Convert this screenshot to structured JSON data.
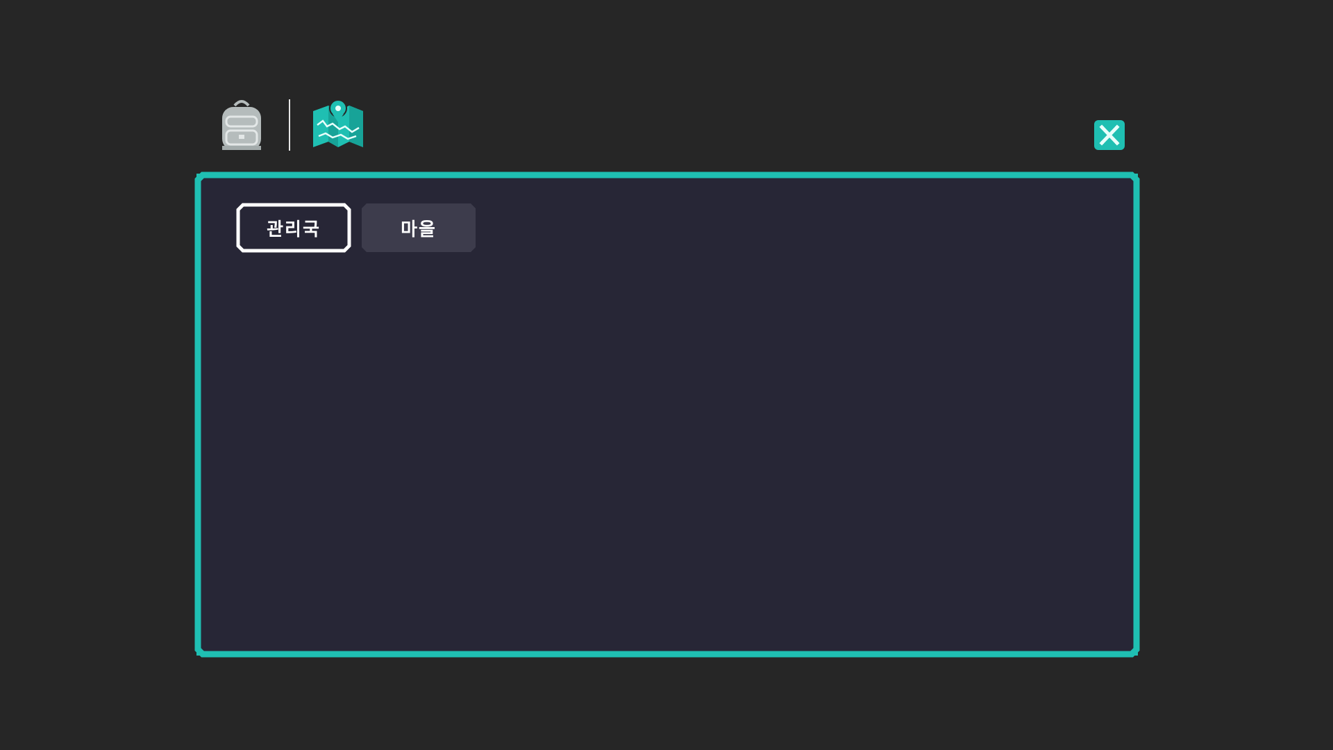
{
  "toolbar": {
    "icons": [
      {
        "name": "backpack-icon",
        "state": "inactive",
        "color": "#b5bcbc"
      },
      {
        "name": "map-icon",
        "state": "active",
        "color": "#1fbfb2"
      }
    ]
  },
  "close_button": {
    "icon": "close-icon",
    "color": "#1fbfb2"
  },
  "panel": {
    "border_color": "#1fbfb2",
    "background_color": "#272636",
    "tabs": [
      {
        "label": "관리국",
        "selected": true
      },
      {
        "label": "마을",
        "selected": false
      }
    ]
  }
}
